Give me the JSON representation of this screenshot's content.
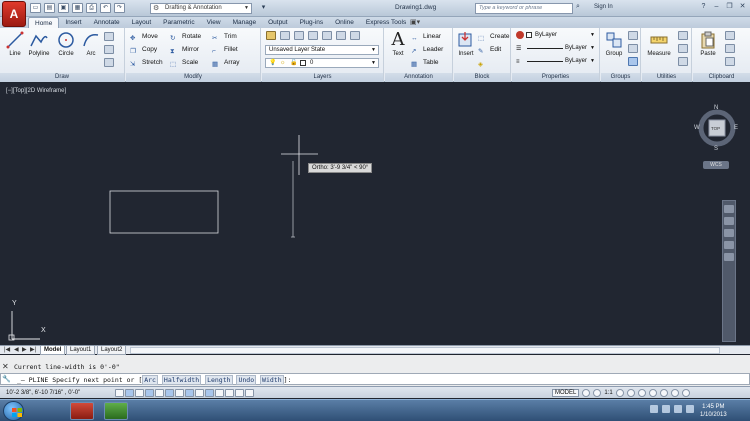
{
  "title_bar": {
    "app_letter": "A",
    "workspace": "Drafting & Annotation",
    "document": "Drawing1.dwg",
    "search_placeholder": "Type a keyword or phrase",
    "sign_in": "Sign In"
  },
  "tabs": [
    "Home",
    "Insert",
    "Annotate",
    "Layout",
    "Parametric",
    "View",
    "Manage",
    "Output",
    "Plug-ins",
    "Online",
    "Express Tools"
  ],
  "active_tab": "Home",
  "ribbon": {
    "draw": {
      "footer": "Draw",
      "tools": [
        "Line",
        "Polyline",
        "Circle",
        "Arc"
      ]
    },
    "modify": {
      "footer": "Modify",
      "tools": [
        "Move",
        "Rotate",
        "Trim",
        "Copy",
        "Mirror",
        "Fillet",
        "Stretch",
        "Scale",
        "Array"
      ]
    },
    "layers": {
      "footer": "Layers",
      "state": "Unsaved Layer State",
      "current": "0"
    },
    "annotation": {
      "footer": "Annotation",
      "big": "Text",
      "tools": [
        "Linear",
        "Leader",
        "Table"
      ]
    },
    "block": {
      "footer": "Block",
      "big": "Insert",
      "tools": [
        "Create",
        "Edit"
      ]
    },
    "properties": {
      "footer": "Properties",
      "color": "ByLayer",
      "linetype": "ByLayer",
      "lineweight": "ByLayer"
    },
    "groups": {
      "footer": "Groups",
      "big": "Group"
    },
    "utilities": {
      "footer": "Utilities",
      "big": "Measure"
    },
    "clipboard": {
      "footer": "Clipboard",
      "big": "Paste"
    }
  },
  "viewport": {
    "label": "[−][Top][2D Wireframe]",
    "tooltip": "Ortho: 3'-9 3/4\" < 90°",
    "viewcube": {
      "n": "N",
      "s": "S",
      "e": "E",
      "w": "W",
      "face": "TOP"
    },
    "wcs": "WCS",
    "ucs_x": "X",
    "ucs_y": "Y"
  },
  "layout_tabs": [
    "Model",
    "Layout1",
    "Layout2"
  ],
  "command": {
    "history": "Current line-width is 0'-0\"",
    "prompt_prefix": "_— PLINE Specify next point or [",
    "options": [
      "Arc",
      "Halfwidth",
      "Length",
      "Undo",
      "Width"
    ],
    "prompt_suffix": "]:"
  },
  "status": {
    "coords": "10'-2 3/8\",  6'-10 7/16\" , 0'-0\"",
    "model": "MODEL",
    "scale": "1:1"
  },
  "taskbar": {
    "time": "1:45 PM",
    "date": "1/10/2013"
  }
}
